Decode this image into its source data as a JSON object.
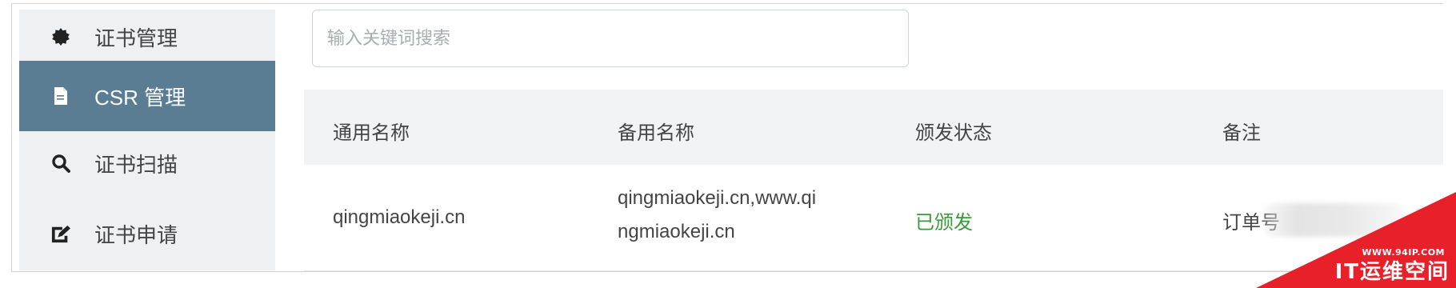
{
  "sidebar": {
    "items": [
      {
        "label": "证书管理",
        "icon": "badge-icon",
        "active": false
      },
      {
        "label": "CSR 管理",
        "icon": "file-icon",
        "active": true
      },
      {
        "label": "证书扫描",
        "icon": "search-icon",
        "active": false
      },
      {
        "label": "证书申请",
        "icon": "edit-icon",
        "active": false
      }
    ]
  },
  "search": {
    "placeholder": "输入关键词搜索",
    "value": ""
  },
  "table": {
    "columns": [
      "通用名称",
      "备用名称",
      "颁发状态",
      "备注"
    ],
    "rows": [
      {
        "common_name": "qingmiaokeji.cn",
        "alt_name_line1": "qingmiaokeji.cn,www.qi",
        "alt_name_line2": "ngmiaokeji.cn",
        "status": "已颁发",
        "note": "订单号"
      }
    ]
  },
  "watermark": {
    "url": "WWW.94IP.COM",
    "name": "IT运维空间"
  },
  "colors": {
    "sidebar_active": "#5a7d93",
    "status_issued": "#3a9a3a",
    "watermark": "#e8202a"
  }
}
